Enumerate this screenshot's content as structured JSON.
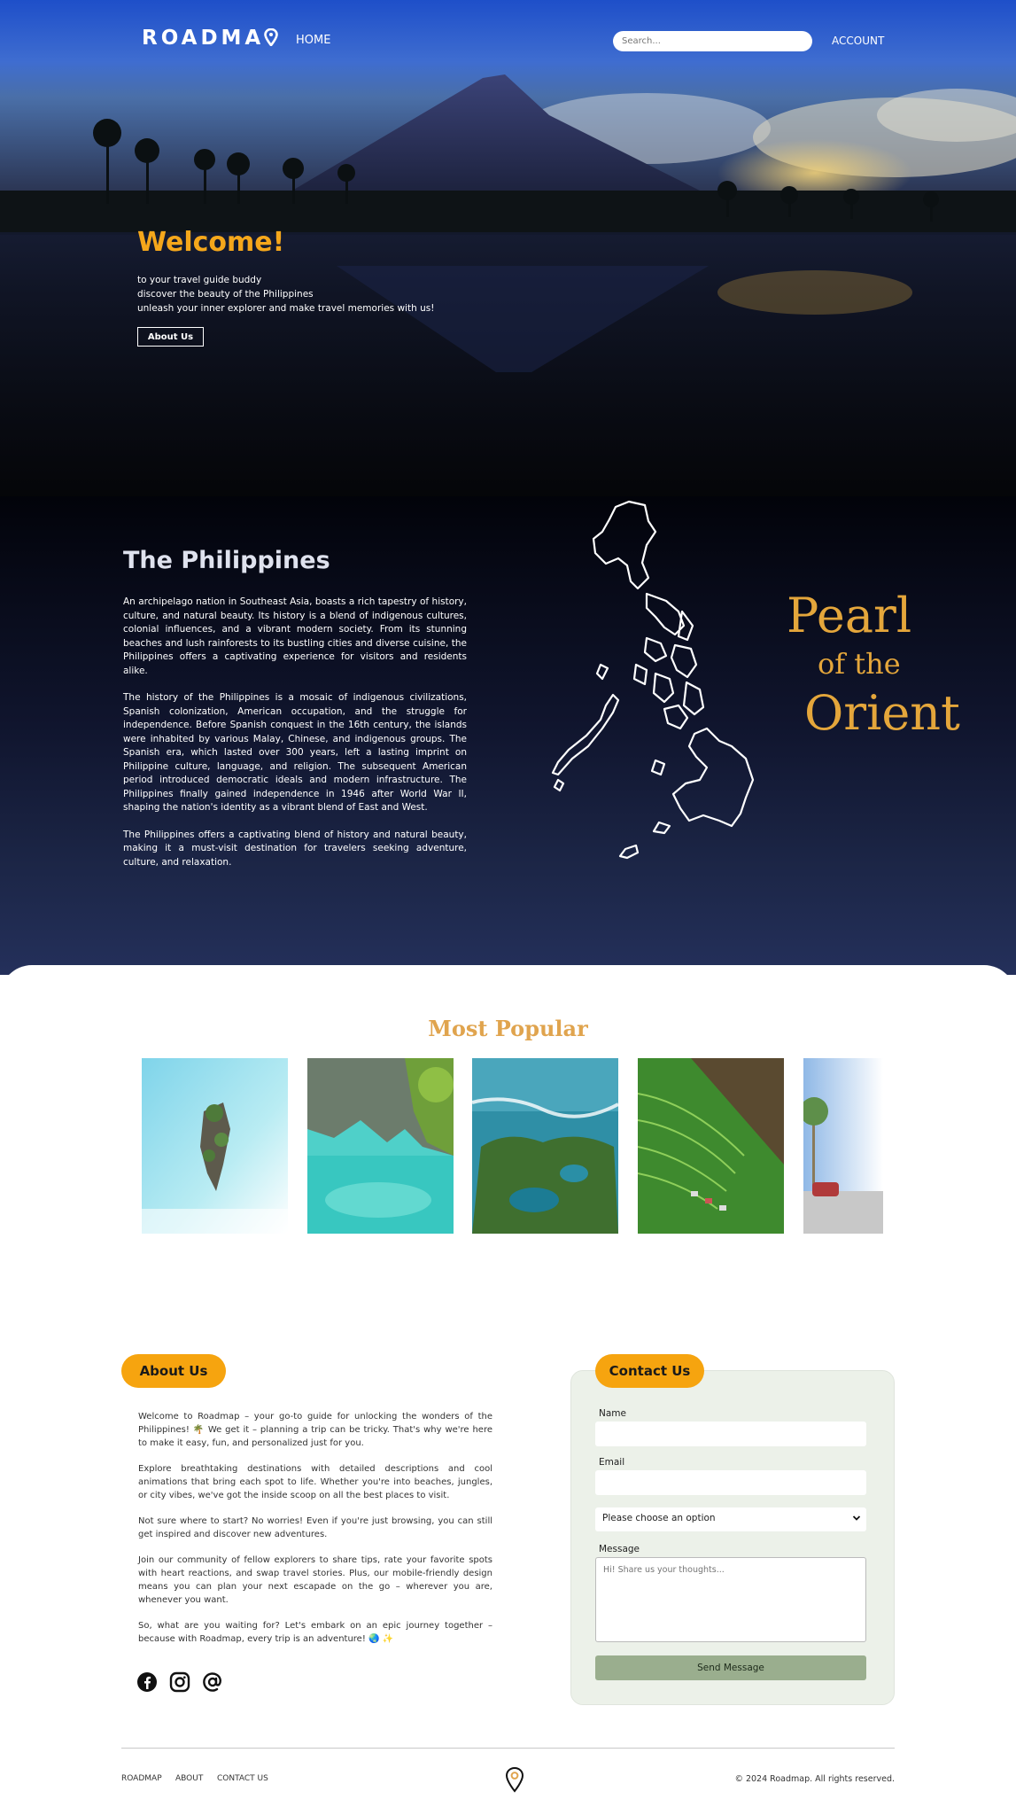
{
  "nav": {
    "logo": "ROADMA",
    "home": "HOME",
    "search_placeholder": "Search...",
    "account": "ACCOUNT"
  },
  "hero": {
    "welcome": "Welcome!",
    "lines": [
      "to your travel guide buddy",
      "discover the beauty of the Philippines",
      "unleash your inner explorer and make travel memories with us!"
    ],
    "about_button": "About Us"
  },
  "philippines": {
    "title": "The Philippines",
    "paragraphs": [
      "An archipelago nation in Southeast Asia, boasts a rich tapestry of history, culture, and natural beauty. Its history is a blend of indigenous cultures, colonial influences, and a vibrant modern society. From its stunning beaches and lush rainforests to its bustling cities and diverse cuisine, the Philippines offers a captivating experience for visitors and residents alike.",
      "The history of the Philippines is a mosaic of indigenous civilizations, Spanish colonization, American occupation, and the struggle for independence. Before Spanish conquest in the 16th century, the islands were inhabited by various Malay, Chinese, and indigenous groups. The Spanish era, which lasted over 300 years, left a lasting imprint on Philippine culture, language, and religion. The subsequent American period introduced democratic ideals and modern infrastructure. The Philippines finally gained independence in 1946 after World War II, shaping the nation's identity as a vibrant blend of East and West.",
      "The Philippines offers a captivating blend of history and natural beauty, making it a must-visit destination for travelers seeking adventure, culture, and relaxation."
    ],
    "tagline": [
      "Pearl",
      "of the",
      "Orient"
    ]
  },
  "popular": {
    "title": "Most Popular",
    "cards": [
      "island-rock-card",
      "lagoon-cliffs-card",
      "green-islands-card",
      "rice-terraces-card",
      "palm-road-card"
    ]
  },
  "about": {
    "title": "About Us",
    "paragraphs": [
      "Welcome to Roadmap – your go-to guide for unlocking the wonders of the Philippines! 🌴 We get it – planning a trip can be tricky. That's why we're here to make it easy, fun, and personalized just for you.",
      "Explore breathtaking destinations with detailed descriptions and cool animations that bring each spot to life. Whether you're into beaches, jungles, or city vibes, we've got the inside scoop on all the best places to visit.",
      "Not sure where to start? No worries! Even if you're just browsing, you can still get inspired and discover new adventures.",
      "Join our community of fellow explorers to share tips, rate your favorite spots with heart reactions, and swap travel stories. Plus, our mobile-friendly design means you can plan your next escapade on the go – wherever you are, whenever you want.",
      "So, what are you waiting for? Let's embark on an epic journey together – because with Roadmap, every trip is an adventure! 🌏 ✨"
    ],
    "social": [
      "facebook-icon",
      "instagram-icon",
      "at-sign-icon"
    ]
  },
  "contact": {
    "title": "Contact Us",
    "name_label": "Name",
    "email_label": "Email",
    "select_value": "Please choose an option",
    "message_label": "Message",
    "message_placeholder": "Hi! Share us your thoughts...",
    "send": "Send Message"
  },
  "footer": {
    "links": [
      "ROADMAP",
      "ABOUT",
      "CONTACT US"
    ],
    "copyright": "© 2024 Roadmap. All rights reserved."
  },
  "colors": {
    "accent_orange": "#f6a40f",
    "gold_text": "#e4a63b",
    "popular_title": "#e0a44e",
    "send_button": "#9aae8e",
    "contact_bg": "#ecf1e9"
  }
}
